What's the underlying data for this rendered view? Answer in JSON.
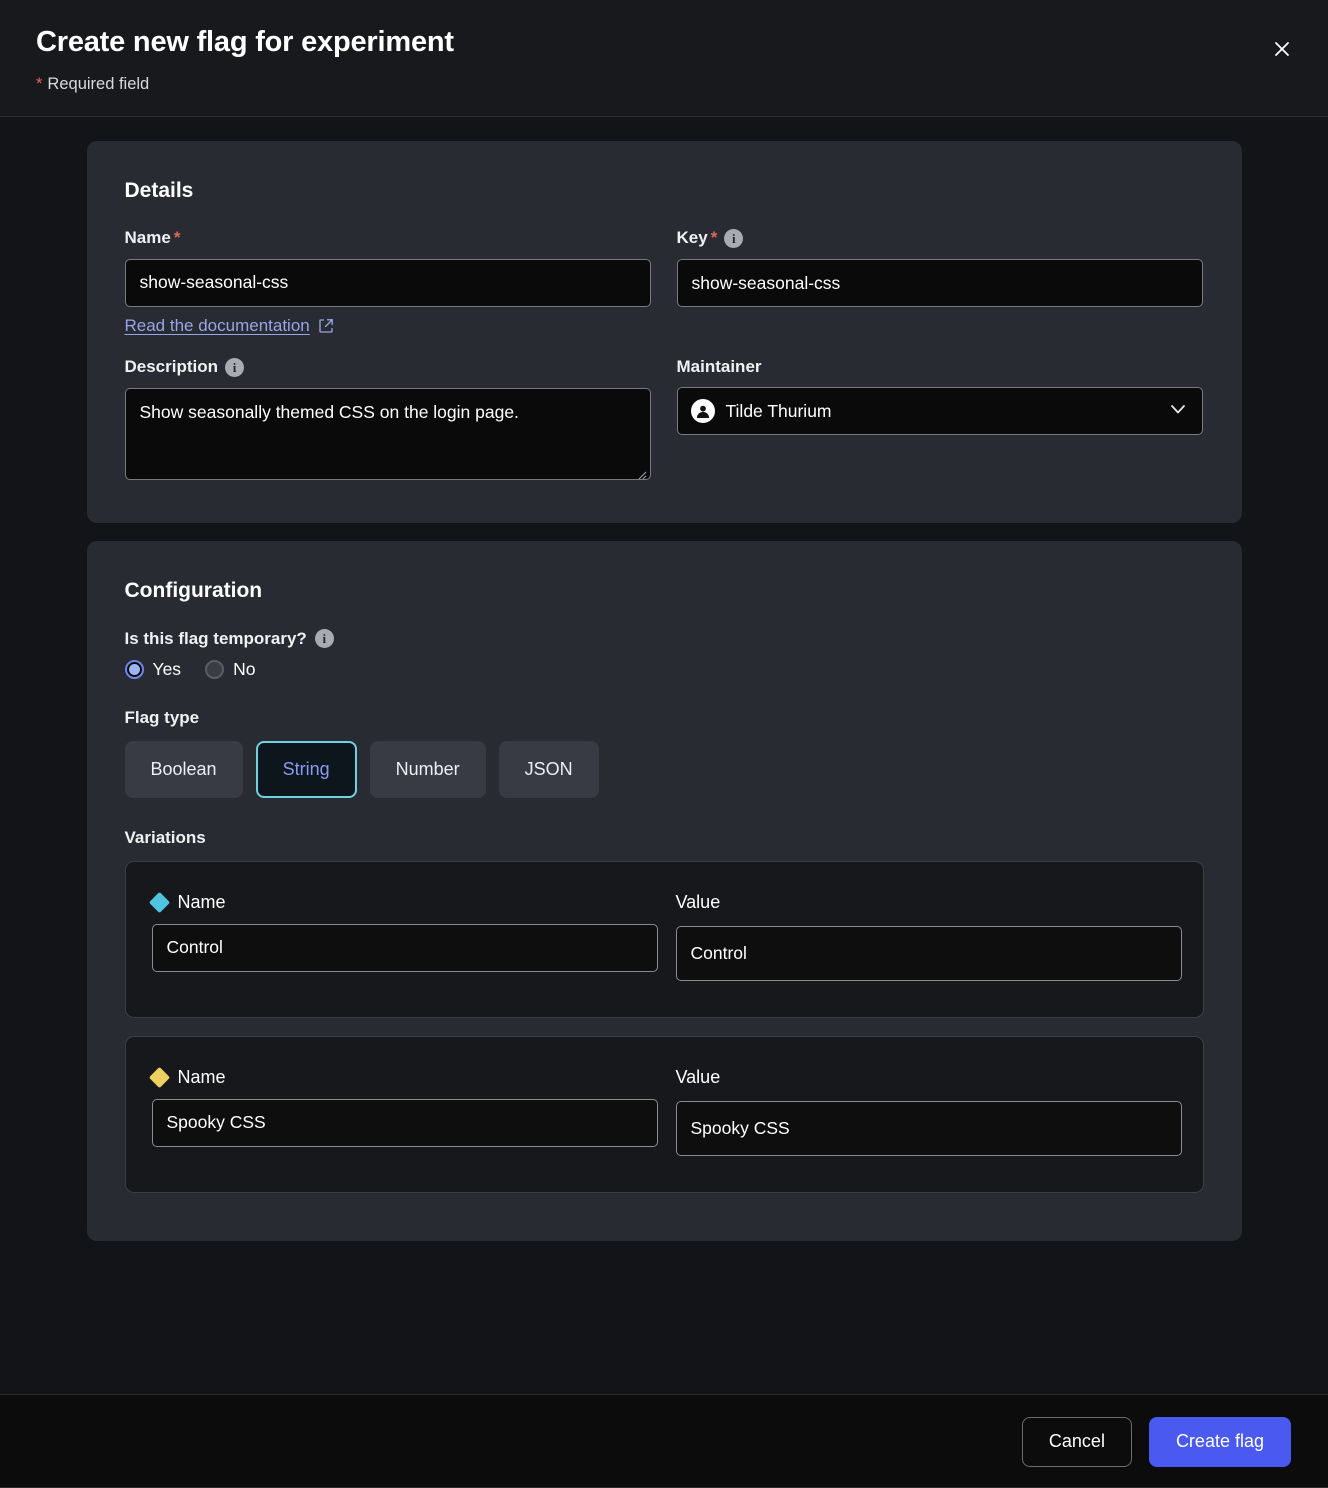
{
  "header": {
    "title": "Create new flag for experiment",
    "required_note": "Required field",
    "required_star": "*",
    "close_label": "close-icon"
  },
  "details": {
    "section_title": "Details",
    "name": {
      "label": "Name",
      "required_star": "*",
      "value": "show-seasonal-css",
      "placeholder": "Name"
    },
    "doc_link": "Read the documentation",
    "key": {
      "label": "Key",
      "required_star": "*",
      "info": "i",
      "value": "show-seasonal-css",
      "placeholder": "Key"
    },
    "description": {
      "label": "Description",
      "info": "i",
      "value": "Show seasonally themed CSS on the login page.",
      "placeholder": "Description"
    },
    "maintainer": {
      "label": "Maintainer",
      "value": "Tilde Thurium"
    }
  },
  "configuration": {
    "section_title": "Configuration",
    "temporary": {
      "label": "Is this flag temporary?",
      "info": "i",
      "options": [
        {
          "label": "Yes",
          "selected": true
        },
        {
          "label": "No",
          "selected": false
        }
      ]
    },
    "flag_type": {
      "label": "Flag type",
      "options": [
        {
          "label": "Boolean",
          "selected": false
        },
        {
          "label": "String",
          "selected": true
        },
        {
          "label": "Number",
          "selected": false
        },
        {
          "label": "JSON",
          "selected": false
        }
      ]
    },
    "variations": {
      "label": "Variations",
      "name_label": "Name",
      "value_label": "Value",
      "items": [
        {
          "color": "#4fc4e0",
          "name": "Control",
          "value": "Control"
        },
        {
          "color": "#edd160",
          "name": "Spooky CSS",
          "value": "Spooky CSS"
        }
      ]
    }
  },
  "footer": {
    "cancel_label": "Cancel",
    "create_label": "Create flag"
  },
  "colors": {
    "accent_primary": "#4a5af0",
    "required_star": "#e2675a",
    "link": "#9aa4e8",
    "selected_type_border": "#6fd2e0",
    "selected_type_text": "#8a9af0",
    "radio_selected": "#9fb5f2",
    "card_bg": "#282b32",
    "page_bg": "#131417"
  }
}
